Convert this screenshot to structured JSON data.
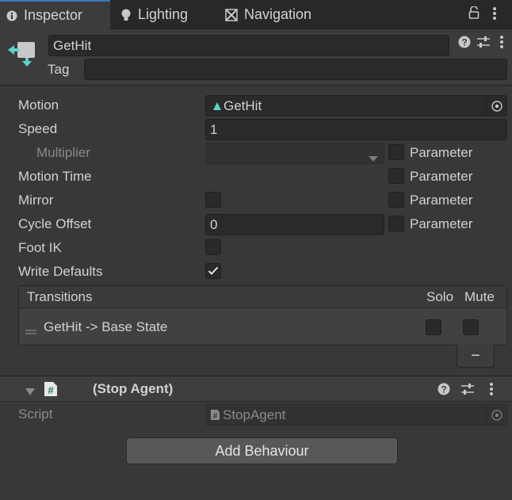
{
  "tabs": [
    {
      "label": "Inspector",
      "icon": "info-icon",
      "active": true
    },
    {
      "label": "Lighting",
      "icon": "lightbulb-icon",
      "active": false
    },
    {
      "label": "Navigation",
      "icon": "navigation-icon",
      "active": false
    }
  ],
  "header": {
    "name_value": "GetHit",
    "tag_label": "Tag",
    "tag_value": ""
  },
  "props": {
    "motion_label": "Motion",
    "motion_value": "GetHit",
    "speed_label": "Speed",
    "speed_value": "1",
    "multiplier_label": "Multiplier",
    "multiplier_value": "",
    "motion_time_label": "Motion Time",
    "mirror_label": "Mirror",
    "cycle_offset_label": "Cycle Offset",
    "cycle_offset_value": "0",
    "foot_ik_label": "Foot IK",
    "write_defaults_label": "Write Defaults",
    "parameter_label": "Parameter"
  },
  "transitions": {
    "title": "Transitions",
    "solo_label": "Solo",
    "mute_label": "Mute",
    "items": [
      {
        "label": "GetHit -> Base State"
      }
    ],
    "remove_label": "−"
  },
  "component": {
    "title": "(Stop Agent)",
    "script_label": "Script",
    "script_value": "StopAgent"
  },
  "add_behaviour_label": "Add Behaviour",
  "colors": {
    "accent": "#3a79bb",
    "motion_icon": "#5fd3c9"
  }
}
